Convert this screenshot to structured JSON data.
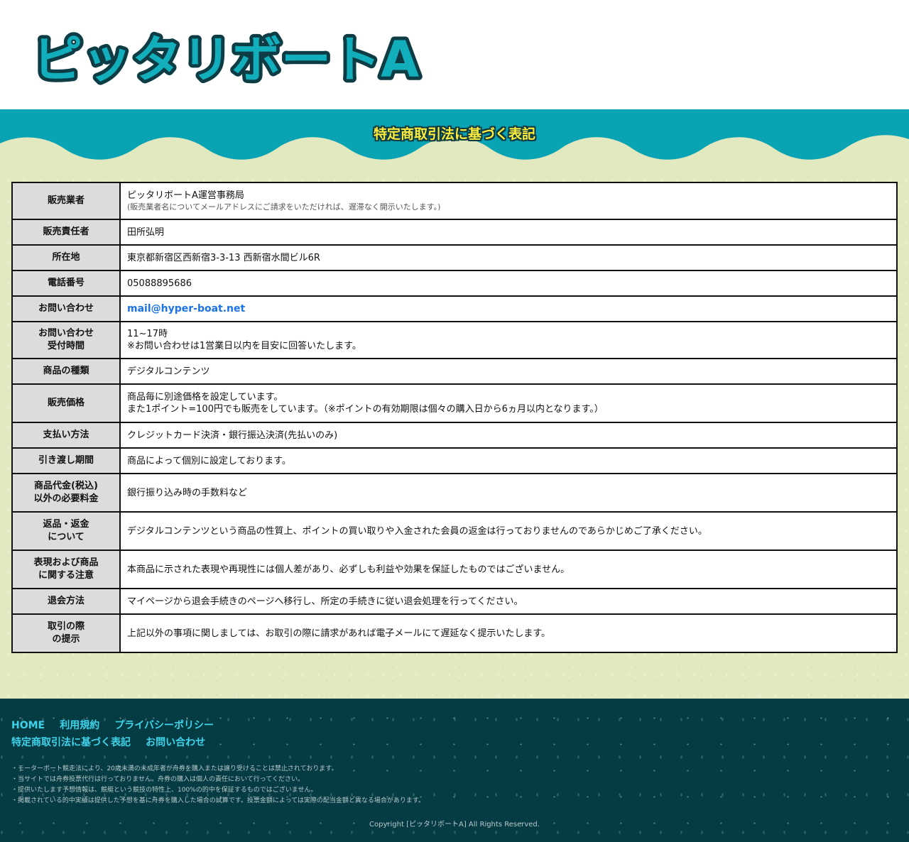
{
  "site": {
    "logo_text": "ピッタリボートA"
  },
  "band": {
    "title": "特定商取引法に基づく表記"
  },
  "table": {
    "rows": [
      {
        "label": [
          "販売業者"
        ],
        "value": [
          "ピッタリボートA運営事務局"
        ],
        "note": "(販売業者名についてメールアドレスにご請求をいただければ、遅滞なく開示いたします。)"
      },
      {
        "label": [
          "販売責任者"
        ],
        "value": [
          "田所弘明"
        ]
      },
      {
        "label": [
          "所在地"
        ],
        "value": [
          "東京都新宿区西新宿3-3-13 西新宿水間ビル6R"
        ]
      },
      {
        "label": [
          "電話番号"
        ],
        "value": [
          "05088895686"
        ]
      },
      {
        "label": [
          "お問い合わせ"
        ],
        "email": "mail@hyper-boat.net"
      },
      {
        "label": [
          "お問い合わせ",
          "受付時間"
        ],
        "value": [
          "11~17時",
          "※お問い合わせは1営業日以内を目安に回答いたします。"
        ]
      },
      {
        "label": [
          "商品の種類"
        ],
        "value": [
          "デジタルコンテンツ"
        ]
      },
      {
        "label": [
          "販売価格"
        ],
        "value": [
          "商品毎に別途価格を設定しています。",
          "また1ポイント=100円でも販売をしています。（※ポイントの有効期限は個々の購入日から6ヵ月以内となります。）"
        ]
      },
      {
        "label": [
          "支払い方法"
        ],
        "value": [
          "クレジットカード決済・銀行振込決済(先払いのみ)"
        ]
      },
      {
        "label": [
          "引き渡し期間"
        ],
        "value": [
          "商品によって個別に設定しております。"
        ]
      },
      {
        "label": [
          "商品代金(税込)",
          "以外の必要料金"
        ],
        "value": [
          "銀行振り込み時の手数料など"
        ]
      },
      {
        "label": [
          "返品・返金",
          "について"
        ],
        "value": [
          "デジタルコンテンツという商品の性質上、ポイントの買い取りや入金された会員の返金は行っておりませんのであらかじめご了承ください。"
        ]
      },
      {
        "label": [
          "表現および商品",
          "に関する注意"
        ],
        "value": [
          "本商品に示された表現や再現性には個人差があり、必ずしも利益や効果を保証したものではございません。"
        ]
      },
      {
        "label": [
          "退会方法"
        ],
        "value": [
          "マイページから退会手続きのページへ移行し、所定の手続きに従い退会処理を行ってください。"
        ]
      },
      {
        "label": [
          "取引の際",
          "の提示"
        ],
        "value": [
          "上記以外の事項に関しましては、お取引の際に請求があれば電子メールにて遅延なく提示いたします。"
        ]
      }
    ]
  },
  "footer": {
    "nav_row1": [
      "HOME",
      "利用規約",
      "プライバシーポリシー"
    ],
    "nav_row2": [
      "特定商取引法に基づく表記",
      "お問い合わせ"
    ],
    "notes": [
      "・モーターボート競走法により、20歳未満の未成年者が舟券を購入または譲り受けることは禁止されております。",
      "・当サイトでは舟券投票代行は行っておりません。舟券の購入は個人の責任において行ってください。",
      "・提供いたします予想情報は、競艇という競技の特性上、100%の的中を保証するものではございません。",
      "・掲載されている的中実績は提供した予想を基に舟券を購入した場合の試算です。投票金額によっては実際の配当金額と異なる場合があります。"
    ],
    "copyright": "Copyright [ピッタリボートA] All Rights Reserved."
  },
  "colors": {
    "teal": "#0aa3b3",
    "dark_teal": "#053c44",
    "sand": "#e2e8c0",
    "logo_yellow": "#ffeb3b",
    "link_blue": "#1a73e8",
    "footer_link": "#3fd3ea"
  }
}
